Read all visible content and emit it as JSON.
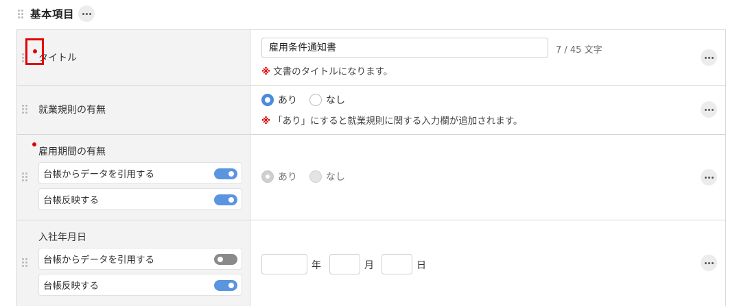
{
  "section": {
    "title": "基本項目"
  },
  "fields": {
    "title": {
      "label": "タイトル",
      "value": "雇用条件通知書",
      "char_count": "7 / 45 文字",
      "note_mark": "※",
      "note": "文書のタイトルになります。"
    },
    "rules": {
      "label": "就業規則の有無",
      "options": [
        "あり",
        "なし"
      ],
      "selected": "あり",
      "note_mark": "※",
      "note": "「あり」にすると就業規則に関する入力欄が追加されます。"
    },
    "period": {
      "label": "雇用期間の有無",
      "sub_options": [
        {
          "label": "台帳からデータを引用する",
          "on": true
        },
        {
          "label": "台帳反映する",
          "on": true
        }
      ],
      "options": [
        "あり",
        "なし"
      ],
      "selected": "あり",
      "disabled": true
    },
    "join_date": {
      "label": "入社年月日",
      "sub_options": [
        {
          "label": "台帳からデータを引用する",
          "on": false
        },
        {
          "label": "台帳反映する",
          "on": true
        }
      ],
      "units": {
        "year": "年",
        "month": "月",
        "day": "日"
      }
    }
  },
  "colors": {
    "required": "#e10000",
    "accent": "#4a8be0",
    "highlight": "#e30000"
  }
}
